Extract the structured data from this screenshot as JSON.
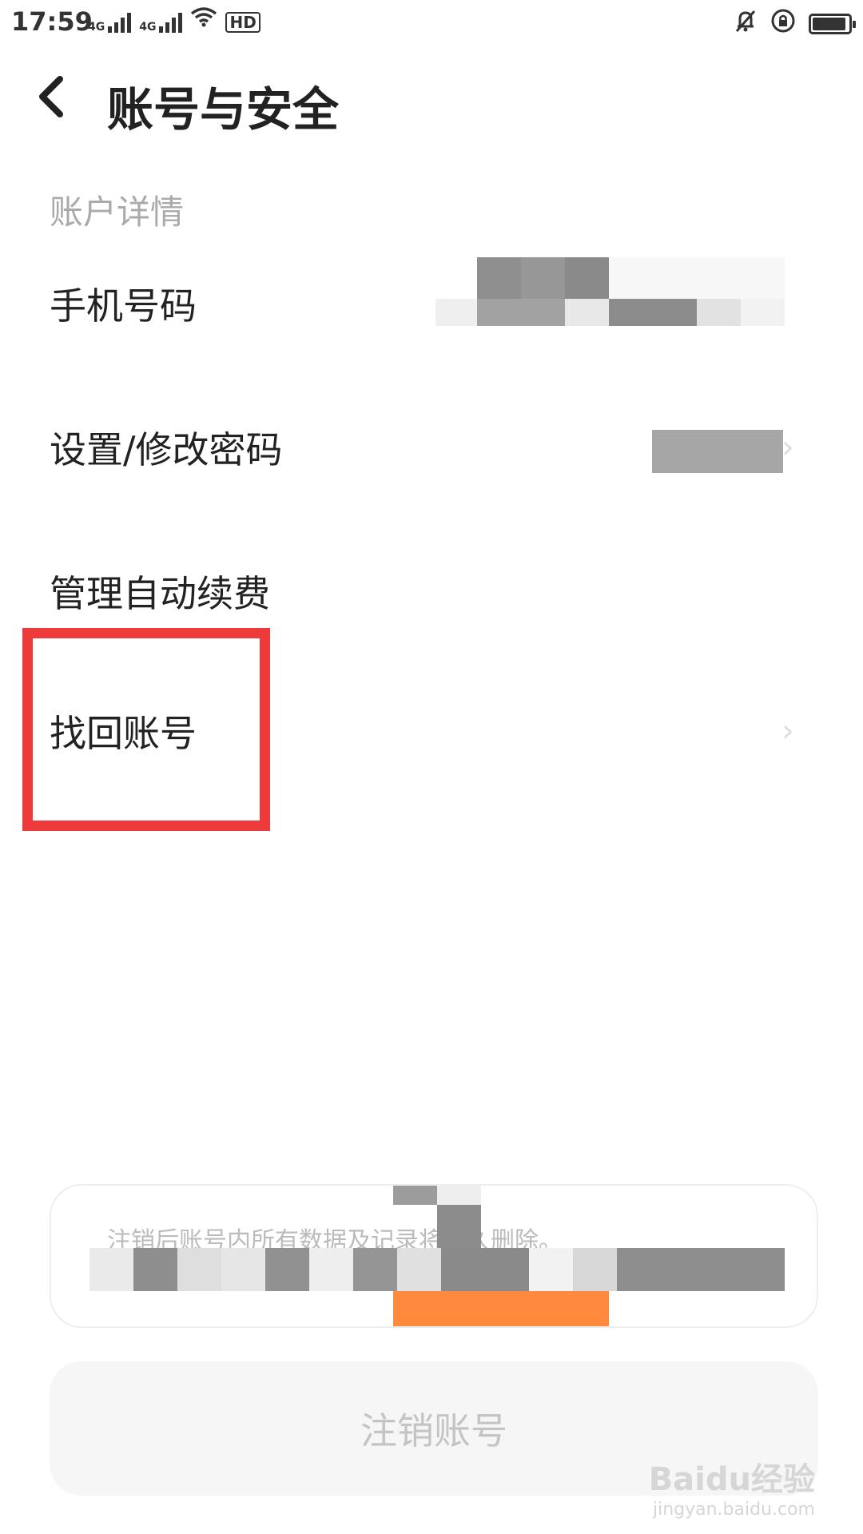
{
  "status_bar": {
    "time": "17:59",
    "network_1": "4G",
    "network_2": "4G",
    "hd": "HD",
    "battery_level": 0.85
  },
  "header": {
    "title": "账号与安全"
  },
  "section": {
    "title": "账户详情"
  },
  "items": [
    {
      "label": "手机号码"
    },
    {
      "label": "设置/修改密码"
    },
    {
      "label": "管理自动续费"
    },
    {
      "label": "找回账号"
    }
  ],
  "notice": {
    "text": "注销后账号内所有数据及记录将永久删除。"
  },
  "deactivate": {
    "label": "注销账号"
  },
  "watermark": {
    "main": "Baidu经验",
    "sub": "jingyan.baidu.com"
  },
  "colors": {
    "highlight": "#ee3a3a",
    "accent": "#ff8a3d"
  }
}
